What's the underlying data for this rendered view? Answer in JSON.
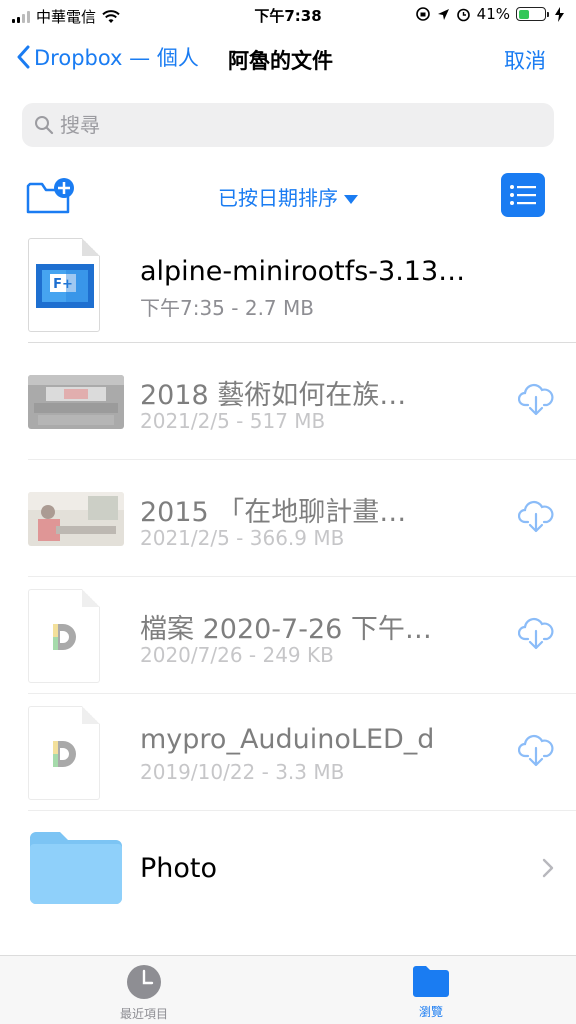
{
  "status": {
    "carrier": "中華電信",
    "time": "下午7:38",
    "battery": "41%",
    "battery_level": 0.41
  },
  "nav": {
    "back_label": "Dropbox — 個人",
    "title": "阿魯的文件",
    "cancel_label": "取消"
  },
  "search": {
    "placeholder": "搜尋"
  },
  "toolbar": {
    "sort_label": "已按日期排序"
  },
  "files": [
    {
      "name": "alpine-minirootfs-3.13…",
      "meta": "下午7:35 - 2.7 MB",
      "icon": "app-file-icon",
      "enabled": true
    },
    {
      "name": "2018 藝術如何在族…",
      "meta": "2021/2/5 - 517 MB",
      "icon": "video-thumbnail",
      "enabled": false
    },
    {
      "name": "2015 「在地聊計畫…",
      "meta": "2021/2/5 - 366.9 MB",
      "icon": "video-thumbnail",
      "enabled": false
    },
    {
      "name": "檔案 2020-7-26 下午…",
      "meta": "2020/7/26 - 249 KB",
      "icon": "d-file-icon",
      "enabled": false
    },
    {
      "name": "mypro_AuduinoLED_d",
      "meta": "2019/10/22 - 3.3 MB",
      "icon": "d-file-icon",
      "enabled": false
    }
  ],
  "folder": {
    "name": "Photo"
  },
  "tabs": {
    "recent": "最近項目",
    "browse": "瀏覽"
  },
  "colors": {
    "accent": "#1a7cf2",
    "folder": "#7cc4f4"
  }
}
